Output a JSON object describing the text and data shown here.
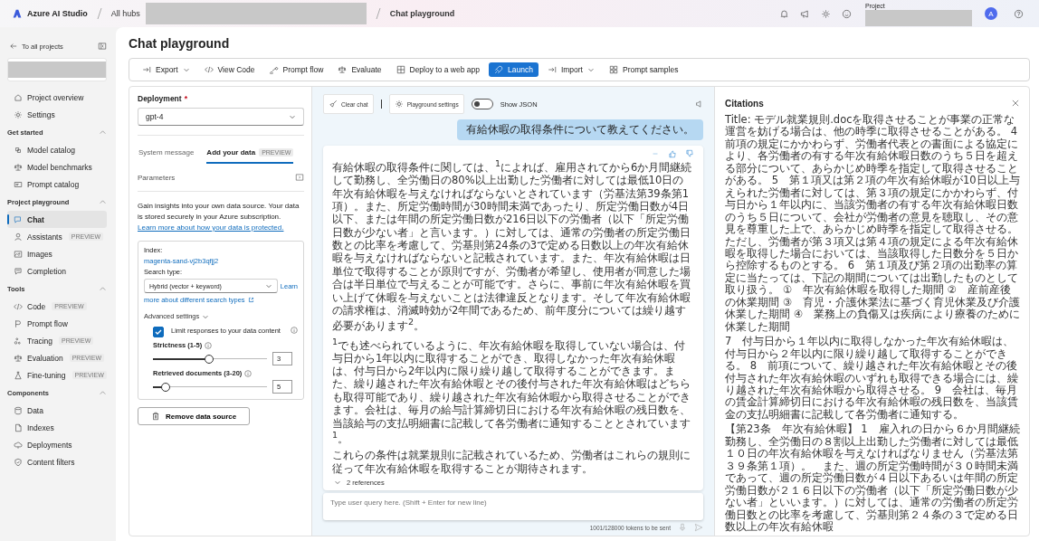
{
  "top_bar": {
    "brand": "Azure AI Studio",
    "breadcrumbs": [
      "All hubs",
      "Chat playground"
    ],
    "project_label": "Project",
    "avatar_initial": "A"
  },
  "sidebar": {
    "back_link": "To all projects",
    "top_items": [
      {
        "label": "Project overview",
        "selected": false
      },
      {
        "label": "Settings",
        "selected": false
      }
    ],
    "sections": [
      {
        "title": "Get started",
        "expanded": true,
        "items": [
          {
            "label": "Model catalog",
            "selected": false
          },
          {
            "label": "Model benchmarks",
            "selected": false
          },
          {
            "label": "Prompt catalog",
            "selected": false
          }
        ]
      },
      {
        "title": "Project playground",
        "expanded": true,
        "items": [
          {
            "label": "Chat",
            "selected": true
          },
          {
            "label": "Assistants",
            "badge": "PREVIEW",
            "selected": false
          },
          {
            "label": "Images",
            "selected": false
          },
          {
            "label": "Completion",
            "selected": false
          }
        ]
      },
      {
        "title": "Tools",
        "expanded": true,
        "items": [
          {
            "label": "Code",
            "badge": "PREVIEW",
            "selected": false
          },
          {
            "label": "Prompt flow",
            "selected": false
          },
          {
            "label": "Tracing",
            "badge": "PREVIEW",
            "selected": false
          },
          {
            "label": "Evaluation",
            "badge": "PREVIEW",
            "selected": false
          },
          {
            "label": "Fine-tuning",
            "badge": "PREVIEW",
            "selected": false
          }
        ]
      },
      {
        "title": "Components",
        "expanded": true,
        "items": [
          {
            "label": "Data",
            "selected": false
          },
          {
            "label": "Indexes",
            "selected": false
          },
          {
            "label": "Deployments",
            "selected": false
          },
          {
            "label": "Content filters",
            "selected": false
          }
        ]
      }
    ]
  },
  "page": {
    "title": "Chat playground",
    "toolbar": [
      {
        "label": "Export",
        "dropdown": true,
        "primary": false
      },
      {
        "label": "View Code",
        "dropdown": false,
        "primary": false
      },
      {
        "label": "Prompt flow",
        "dropdown": false,
        "primary": false
      },
      {
        "label": "Evaluate",
        "dropdown": false,
        "primary": false
      },
      {
        "label": "Deploy to a web app",
        "dropdown": false,
        "primary": false
      },
      {
        "label": "Launch",
        "dropdown": false,
        "primary": true
      },
      {
        "label": "Import",
        "dropdown": true,
        "primary": false
      },
      {
        "label": "Prompt samples",
        "dropdown": false,
        "primary": false
      }
    ]
  },
  "setup": {
    "deployment": {
      "label": "Deployment",
      "required": true,
      "required_mark": "*",
      "value": "gpt-4"
    },
    "tabs": [
      {
        "label": "System message",
        "selected": false
      },
      {
        "label": "Add your data",
        "badge": "PREVIEW",
        "selected": true
      }
    ],
    "parameters": {
      "label": "Parameters"
    },
    "intro": {
      "text": "Gain insights into your own data source. Your data is stored securely in your Azure subscription.",
      "link": "Learn more about how your data is protected."
    },
    "data_source": {
      "index_label": "Index:",
      "index_value": "magenta-sand-vj2b3qfjj2",
      "search_type_label": "Search type:",
      "search_type_value": "Hybrid (vector + keyword)",
      "search_link": [
        "Learn",
        "more about different search types"
      ],
      "advanced_label": "Advanced settings",
      "advanced_expanded": true,
      "limit_responses": {
        "label": "Limit responses to your data content",
        "checked": true
      },
      "sliders": [
        {
          "label": "Strictness (1-5)",
          "level": 0.5,
          "value": "3"
        },
        {
          "label": "Retrieved documents (3-20)",
          "level": 0.12,
          "value": "5"
        }
      ]
    },
    "remove_button": "Remove data source"
  },
  "chat": {
    "clear_button": "Clear chat",
    "settings_button": "Playground settings",
    "show_json": {
      "label": "Show JSON",
      "on": false
    },
    "messages": [
      {
        "kind": "user",
        "text": "有給休暇の取得条件について教えてください。"
      },
      {
        "kind": "assistant",
        "paragraphs": [
          "有給休暇の取得条件に関しては、$^{1}$によれば、雇用されてから6か月間継続して勤務し、全労働日の80%以上出勤した労働者に対しては最低10日の年次有給休暇を与えなければならないとされています（労基法第39条第1項）。また、所定労働時間が30時間未満であったり、所定労働日数が4日以下、または年間の所定労働日数が216日以下の労働者（以下「所定労働日数が少ない者」と言います。）に対しては、通常の労働者の所定労働日数との比率を考慮して、労基則第24条の3で定める日数以上の年次有給休暇を与えなければならないと記載されています。また、年次有給休暇は日単位で取得することが原則ですが、労働者が希望し、使用者が同意した場合は半日単位で与えることが可能です。さらに、事前に年次有給休暇を買い上げて休暇を与えないことは法律違反となります。そして年次有給休暇の請求権は、消滅時効が2年間であるため、前年度分については繰り越す必要があります$^{2}$。",
          "$^{1}$でも述べられているように、年次有給休暇を取得していない場合は、付与日から1年以内に取得することができ、取得しなかった年次有給休暇は、付与日から2年以内に限り繰り越して取得することができます。また、繰り越された年次有給休暇とその後付与された年次有給休暇はどちらも取得可能であり、繰り越された年次有給休暇から取得させることができます。会社は、毎月の給与計算締切日における年次有給休暇の残日数を、当該給与の支払明細書に記載して各労働者に通知することとされています$^{1}$。",
          "これらの条件は就業規則に記載されているため、労働者はこれらの規則に従って年次有給休暇を取得することが期待されます。"
        ],
        "references": {
          "label": "2 references",
          "expanded": false
        }
      }
    ],
    "input": {
      "placeholder": "Type user query here. (Shift + Enter for new line)"
    },
    "token_count": "1001/128000 tokens to be sent"
  },
  "citations": {
    "title": "Citations",
    "paragraphs": [
      "Title: モデル就業規則.docを取得させることが事業の正常な運営を妨げる場合は、他の時季に取得させることがある。 4　前項の規定にかかわらず、労働者代表との書面による協定により、各労働者の有する年次有給休暇日数のうち５日を超える部分について、あらかじめ時季を指定して取得させることがある。 5　第１項又は第２項の年次有給休暇が10日以上与えられた労働者に対しては、第３項の規定にかかわらず、付与日から１年以内に、当該労働者の有する年次有給休暇日数のうち５日について、会社が労働者の意見を聴取し、その意見を尊重した上で、あらかじめ時季を指定して取得させる。ただし、労働者が第３項又は第４項の規定による年次有給休暇を取得した場合においては、当該取得した日数分を５日から控除するものとする。 6　第１項及び第２項の出勤率の算定に当たっては、下記の期間については出勤したものとして取り扱う。 ①　年次有給休暇を取得した期間 ②　産前産後の休業期間 ③　育児・介護休業法に基づく育児休業及び介護休業した期間 ④　業務上の負傷又は疾病により療養のために休業した期間",
      "7　付与日から１年以内に取得しなかった年次有給休暇は、付与日から２年以内に限り繰り越して取得することができる。 8　前項について、繰り越された年次有給休暇とその後付与された年次有給休暇のいずれも取得できる場合には、繰り越された年次有給休暇から取得させる。 9　会社は、毎月の賃金計算締切日における年次有給休暇の残日数を、当該賃金の支払明細書に記載して各労働者に通知する。",
      "【第23条　年次有給休暇】 1　雇入れの日から６か月間継続勤務し、全労働日の８割以上出勤した労働者に対しては最低１０日の年次有給休暇を与えなければなりません（労基法第３９条第１項）。　また、週の所定労働時間が３０時間未満であって、週の所定労働日数が４日以下あるいは年間の所定労働日数が２１６日以下の労働者（以下「所定労働日数が少ない者」といいます。）に対しては、通常の労働者の所定労働日数との比率を考慮して、労基則第２４条の３で定める日数以上の年次有給休暇"
    ]
  }
}
